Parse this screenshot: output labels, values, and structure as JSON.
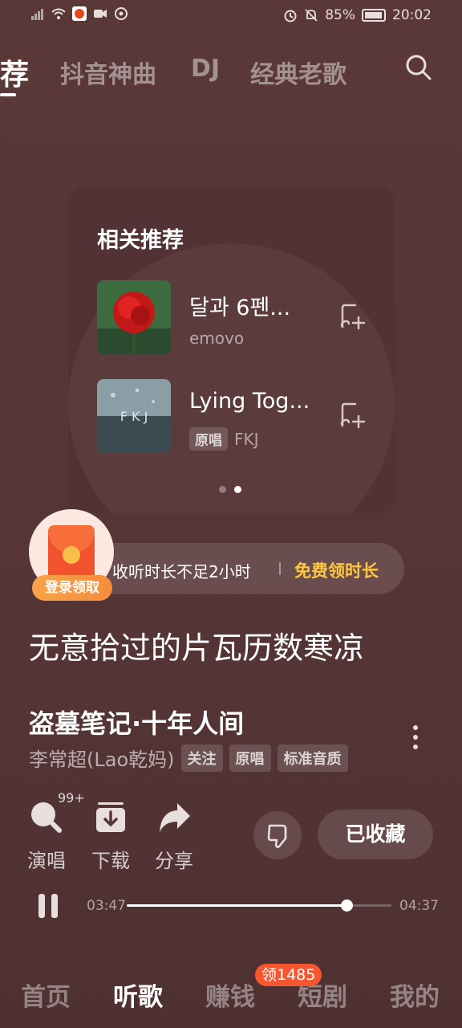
{
  "status_bar": {
    "battery": "85%",
    "time": "20:02"
  },
  "tabs": {
    "items": [
      {
        "label": "荐",
        "active": true
      },
      {
        "label": "抖音神曲",
        "active": false
      },
      {
        "label": "DJ",
        "active": false
      },
      {
        "label": "经典老歌",
        "active": false
      }
    ]
  },
  "recommend": {
    "title": "相关推荐",
    "items": [
      {
        "name": "달과 6펜...",
        "artist": "emovo",
        "tag": ""
      },
      {
        "name": "Lying Tog...",
        "artist": "FKJ",
        "tag": "原唱"
      }
    ],
    "page_index": 1,
    "page_count": 2
  },
  "listen_banner": {
    "text": "收听时长不足2小时",
    "cta": "免费领时长",
    "login_badge": "登录领取"
  },
  "lyric": "无意拾过的片瓦历数寒凉",
  "song": {
    "title": "盗墓笔记·十年人间",
    "artist": "李常超(Lao乾妈)",
    "tags": [
      "关注",
      "原唱",
      "标准音质"
    ]
  },
  "actions": {
    "sing": "演唱",
    "sing_badge": "99+",
    "download": "下载",
    "share": "分享",
    "favorite": "已收藏"
  },
  "player": {
    "current_time": "03:47",
    "total_time": "04:37",
    "progress": 0.83
  },
  "bottom_nav": {
    "items": [
      {
        "label": "首页",
        "active": false
      },
      {
        "label": "听歌",
        "active": true
      },
      {
        "label": "赚钱",
        "active": false
      },
      {
        "label": "短剧",
        "active": false
      },
      {
        "label": "我的",
        "active": false
      }
    ],
    "badge": "领1485"
  },
  "colors": {
    "accent_gold": "#ffc840",
    "badge_red": "#f5552f",
    "login_orange": "#f8a34a",
    "background": "#583637"
  }
}
